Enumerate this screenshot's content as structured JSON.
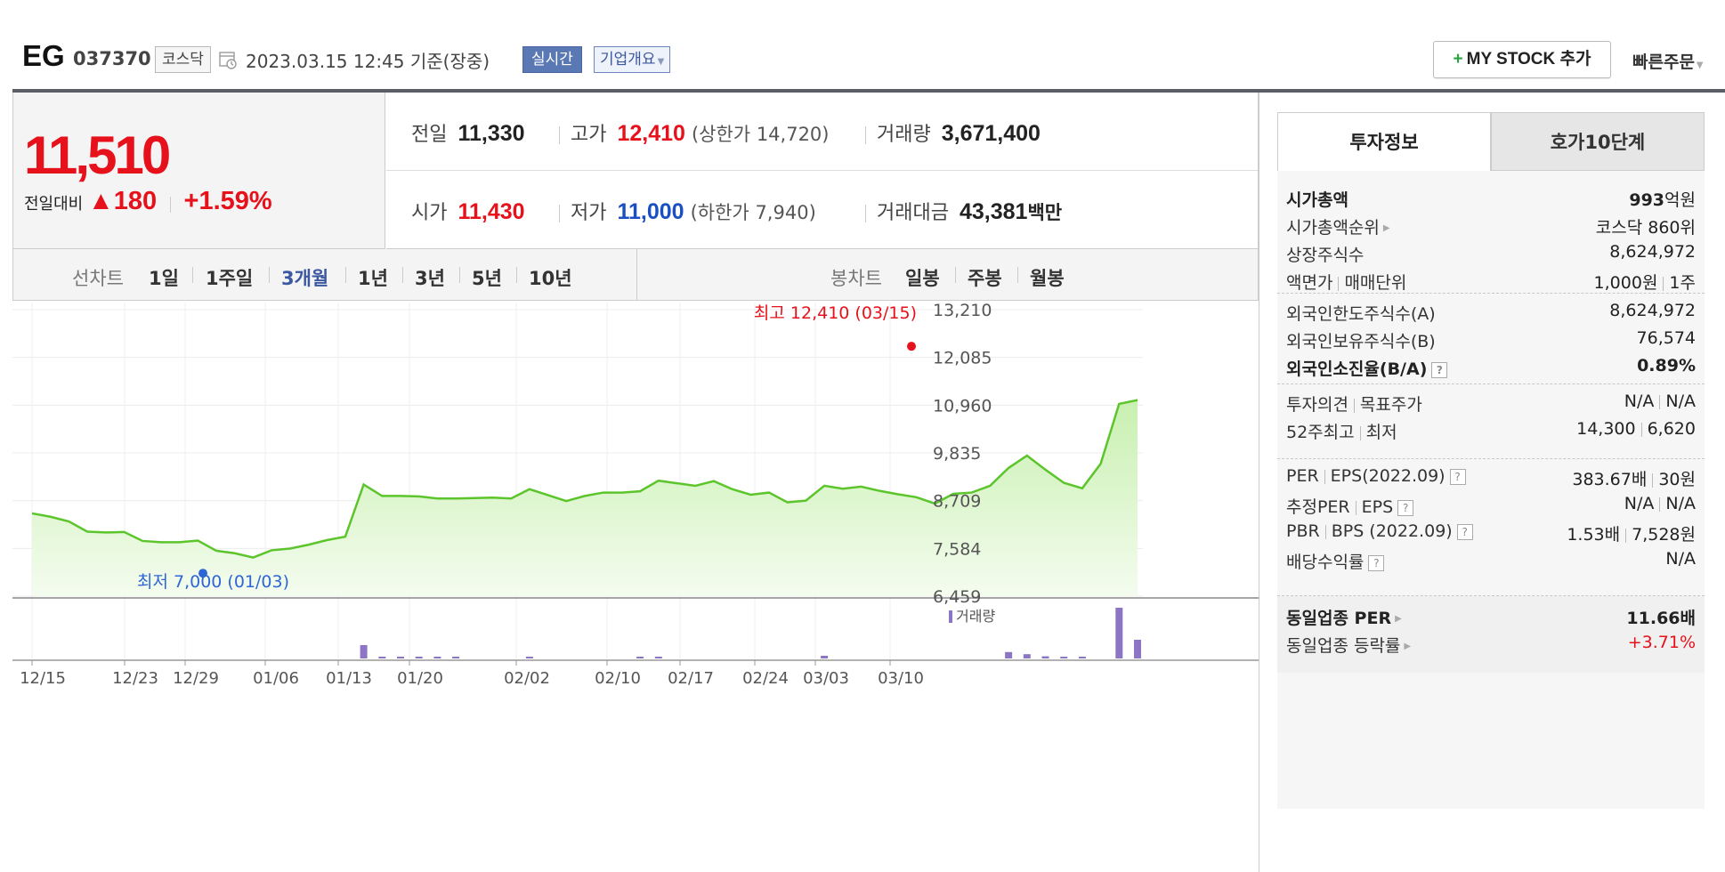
{
  "header": {
    "name": "EG",
    "code": "037370",
    "market": "코스닥",
    "date": "2023.03.15 12:45",
    "basis": "기준(장중)",
    "realtime": "실시간",
    "company_info": "기업개요",
    "mystock": "MY STOCK 추가",
    "quick_order": "빠른주문"
  },
  "price": {
    "current": "11,510",
    "change_label": "전일대비",
    "change_value": "180",
    "change_pct": "+1.59%",
    "rows": [
      [
        {
          "label": "전일",
          "value": "11,330",
          "color": "#222222"
        },
        {
          "label": "고가",
          "value": "12,410",
          "color": "#e6111a",
          "sub_label": "상한가",
          "sub_value": "14,720"
        },
        {
          "label": "거래량",
          "value": "3,671,400",
          "color": "#222222"
        }
      ],
      [
        {
          "label": "시가",
          "value": "11,430",
          "color": "#e6111a"
        },
        {
          "label": "저가",
          "value": "11,000",
          "color": "#1a4fc4",
          "sub_label": "하한가",
          "sub_value": "7,940"
        },
        {
          "label": "거래대금",
          "value": "43,381",
          "unit": "백만",
          "color": "#222222"
        }
      ]
    ]
  },
  "period": {
    "line_label": "선차트",
    "line_items": [
      "1일",
      "1주일",
      "3개월",
      "1년",
      "3년",
      "5년",
      "10년"
    ],
    "selected": "3개월",
    "candle_label": "봉차트",
    "candle_items": [
      "일봉",
      "주봉",
      "월봉"
    ]
  },
  "chart_data": {
    "type": "area",
    "y_ticks": [
      "13,210",
      "12,085",
      "10,960",
      "9,835",
      "8,709",
      "7,584",
      "6,459"
    ],
    "ylim": [
      6459,
      13210
    ],
    "x_ticks": [
      "12/15",
      "12/23",
      "12/29",
      "01/06",
      "01/13",
      "01/20",
      "02/02",
      "02/10",
      "02/17",
      "02/24",
      "03/03",
      "03/10"
    ],
    "prices": [
      8410,
      8330,
      8220,
      7980,
      7960,
      7970,
      7760,
      7730,
      7730,
      7770,
      7530,
      7470,
      7370,
      7540,
      7580,
      7670,
      7780,
      7860,
      9090,
      8820,
      8820,
      8810,
      8760,
      8760,
      8770,
      8780,
      8760,
      8980,
      8840,
      8700,
      8820,
      8900,
      8900,
      8930,
      9180,
      9120,
      9060,
      9170,
      8980,
      8850,
      8900,
      8670,
      8710,
      9060,
      8990,
      9040,
      8940,
      8860,
      8790,
      8640,
      8870,
      8900,
      9060,
      9480,
      9770,
      9440,
      9130,
      9000,
      9580,
      10990,
      11080
    ],
    "volume": [
      0,
      0,
      0,
      0,
      0,
      0,
      0,
      0,
      0,
      0,
      0,
      0,
      0,
      0,
      0,
      0,
      0,
      0,
      0.25,
      0.02,
      0.02,
      0.02,
      0.02,
      0.02,
      0,
      0,
      0,
      0.02,
      0,
      0,
      0,
      0,
      0,
      0.02,
      0.02,
      0,
      0,
      0,
      0,
      0,
      0,
      0,
      0,
      0.05,
      0,
      0,
      0,
      0,
      0,
      0,
      0,
      0,
      0,
      0.12,
      0.08,
      0.04,
      0.03,
      0.02,
      0,
      0.95,
      0.35
    ],
    "high_label": "최고 12,410 (03/15)",
    "high_value": 12410,
    "low_label": "최저 7,000 (01/03)",
    "low_value": 7000,
    "volume_label": "거래량",
    "colors": {
      "line": "#5cc52c",
      "fill_top": "#c8f0b0",
      "fill_bottom": "#f4fcef",
      "high": "#e6111a",
      "low": "#2f66d6",
      "volume": "#8b75c4"
    }
  },
  "invest": {
    "tab_invest": "투자정보",
    "tab_quote": "호가10단계",
    "sections": [
      [
        {
          "k": "시가총액",
          "v": "993",
          "v_unit": "억원",
          "bold": true
        },
        {
          "k": "시가총액순위",
          "v": "코스닥 860위",
          "arrow": true
        },
        {
          "k": "상장주식수",
          "v": "8,624,972"
        },
        {
          "k": "액면가",
          "k2": "매매단위",
          "v": "1,000원",
          "v2": "1주"
        }
      ],
      [
        {
          "k": "외국인한도주식수(A)",
          "v": "8,624,972"
        },
        {
          "k": "외국인보유주식수(B)",
          "v": "76,574"
        },
        {
          "k": "외국인소진율(B/A)",
          "v": "0.89%",
          "bold": true,
          "help": true
        }
      ],
      [
        {
          "k": "투자의견",
          "k2": "목표주가",
          "v": "N/A",
          "v2": "N/A"
        },
        {
          "k": "52주최고",
          "k2": "최저",
          "v": "14,300",
          "v2": "6,620"
        }
      ],
      [
        {
          "k": "PER",
          "k2": "EPS(2022.09)",
          "v": "383.67배",
          "v2": "30원",
          "help": true
        },
        {
          "k": "추정PER",
          "k2": "EPS",
          "v": "N/A",
          "v2": "N/A",
          "help": true
        },
        {
          "k": "PBR",
          "k2": "BPS (2022.09)",
          "v": "1.53배",
          "v2": "7,528원",
          "help": true
        },
        {
          "k": "배당수익률",
          "v": "N/A",
          "help": true
        }
      ],
      [
        {
          "k": "동일업종 PER",
          "v": "11.66배",
          "bold": true,
          "arrow": true
        },
        {
          "k": "동일업종 등락률",
          "v": "+3.71%",
          "red": true,
          "arrow": true
        }
      ]
    ]
  }
}
